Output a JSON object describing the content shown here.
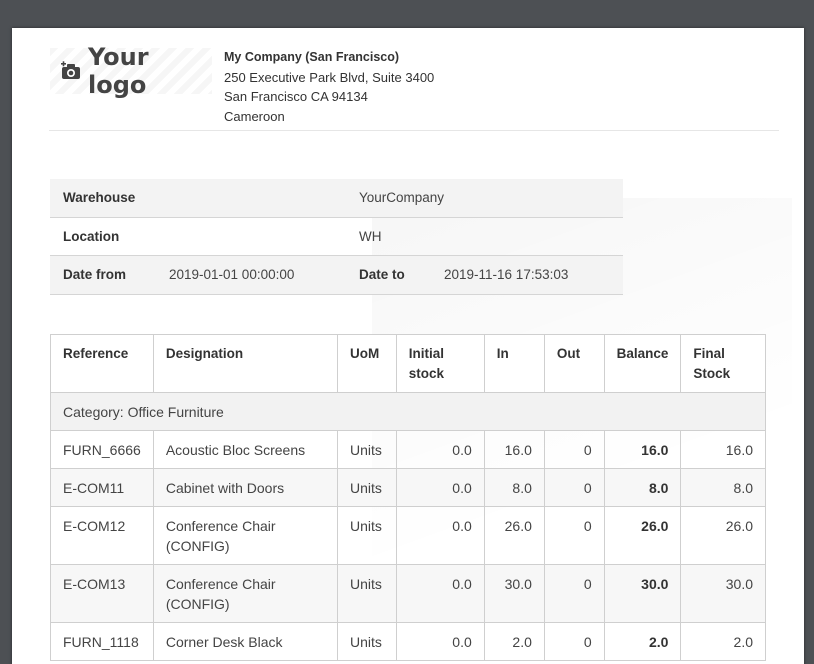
{
  "logo": {
    "text": "Your logo",
    "icon": "camera-icon"
  },
  "company": {
    "name": "My Company (San Francisco)",
    "address1": "250 Executive Park Blvd, Suite 3400",
    "address2": "San Francisco CA 94134",
    "country": "Cameroon"
  },
  "info": {
    "warehouse_label": "Warehouse",
    "warehouse_value": "YourCompany",
    "location_label": "Location",
    "location_value": "WH",
    "date_from_label": "Date from",
    "date_from_value": "2019-01-01 00:00:00",
    "date_to_label": "Date to",
    "date_to_value": "2019-11-16 17:53:03"
  },
  "table": {
    "headers": [
      "Reference",
      "Designation",
      "UoM",
      "Initial stock",
      "In",
      "Out",
      "Balance",
      "Final Stock"
    ],
    "category": "Category: Office Furniture",
    "rows": [
      {
        "ref": "FURN_6666",
        "designation": "Acoustic Bloc Screens",
        "uom": "Units",
        "initial": "0.0",
        "in": "16.0",
        "out": "0",
        "balance": "16.0",
        "final": "16.0"
      },
      {
        "ref": "E-COM11",
        "designation": "Cabinet with Doors",
        "uom": "Units",
        "initial": "0.0",
        "in": "8.0",
        "out": "0",
        "balance": "8.0",
        "final": "8.0"
      },
      {
        "ref": "E-COM12",
        "designation": "Conference Chair (CONFIG)",
        "uom": "Units",
        "initial": "0.0",
        "in": "26.0",
        "out": "0",
        "balance": "26.0",
        "final": "26.0"
      },
      {
        "ref": "E-COM13",
        "designation": "Conference Chair (CONFIG)",
        "uom": "Units",
        "initial": "0.0",
        "in": "30.0",
        "out": "0",
        "balance": "30.0",
        "final": "30.0"
      },
      {
        "ref": "FURN_1118",
        "designation": "Corner Desk Black",
        "uom": "Units",
        "initial": "0.0",
        "in": "2.0",
        "out": "0",
        "balance": "2.0",
        "final": "2.0"
      }
    ]
  }
}
